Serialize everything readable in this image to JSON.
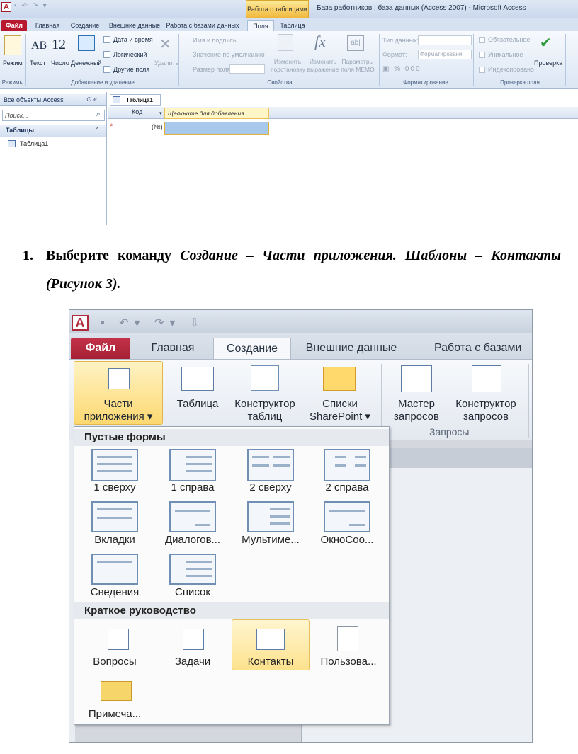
{
  "s1": {
    "window_title": "База работников : база данных (Access 2007) - Microsoft Access",
    "context_tab": "Работа с таблицами",
    "tabs": [
      "Файл",
      "Главная",
      "Создание",
      "Внешние данные",
      "Работа с базами данных",
      "Поля",
      "Таблица"
    ],
    "ribbon": {
      "view": "Режим",
      "text": "Текст",
      "number": "Число",
      "currency": "Денежный",
      "datetime": "Дата и время",
      "logical": "Логический",
      "other": "Другие поля",
      "delete": "Удалить",
      "name_caption": "Имя и подпись",
      "default_value": "Значение по умолчанию",
      "field_size": "Размер поля",
      "change_lookup": "Изменить подстановку",
      "change_expr": "Изменить выражение",
      "memo_params": "Параметры поля MEMO",
      "data_type": "Тип данных:",
      "format": "Формат:",
      "format_value": "Форматировани",
      "required": "Обязательное",
      "unique": "Уникальное",
      "indexed": "Индексировано",
      "validation": "Проверка",
      "group_views": "Режимы",
      "group_add": "Добавление и удаление",
      "group_props": "Свойства",
      "group_format": "Форматирование",
      "group_check": "Проверка поля",
      "icon_ab": "AB",
      "icon_12": "12",
      "icon_fx": "fx",
      "icon_abl": "ab|",
      "fmt_percent": "%",
      "fmt_thousands": "000"
    },
    "nav": {
      "header": "Все объекты Access",
      "search_placeholder": "Поиск...",
      "group": "Таблицы",
      "item": "Таблица1"
    },
    "doc_tab": "Таблица1",
    "grid": {
      "col1": "Код",
      "col2": "Щелкните для добавления",
      "new_row_marker": "*",
      "new_value": "(№)"
    }
  },
  "step": {
    "number": "1.",
    "text_a": "Выберите команду ",
    "italic": "Создание – Части приложения. Шаблоны – Контакты (Рисунок 3)."
  },
  "s2": {
    "tabs": [
      "Файл",
      "Главная",
      "Создание",
      "Внешние данные",
      "Работа с базами"
    ],
    "buttons": {
      "parts_line1": "Части",
      "parts_line2": "приложения ▾",
      "table": "Таблица",
      "designer_1": "Конструктор",
      "designer_2": "таблиц",
      "sp_1": "Списки",
      "sp_2": "SharePoint ▾",
      "wizard_1": "Мастер",
      "wizard_2": "запросов",
      "qdesign_1": "Конструктор",
      "qdesign_2": "запросов"
    },
    "group_queries": "Запросы",
    "menu": {
      "section1": "Пустые формы",
      "blank": [
        "1 сверху",
        "1 справа",
        "2 сверху",
        "2 справа",
        "Вкладки",
        "Диалогов...",
        "Мультиме...",
        "ОкноСоо...",
        "Сведения",
        "Список"
      ],
      "section2": "Краткое руководство",
      "quick": [
        "Вопросы",
        "Задачи",
        "Контакты",
        "Пользова...",
        "Примеча..."
      ],
      "selected": "Контакты"
    }
  }
}
